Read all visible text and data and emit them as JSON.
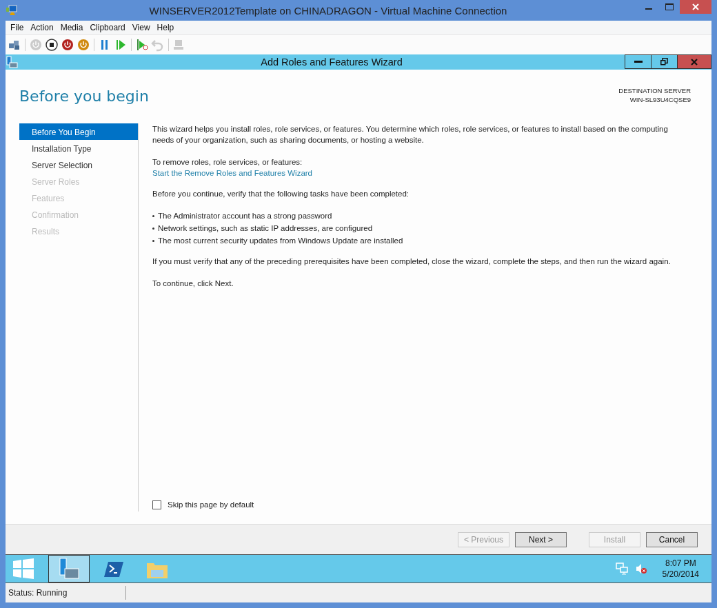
{
  "window": {
    "title": "WINSERVER2012Template on CHINADRAGON - Virtual Machine Connection"
  },
  "menu": [
    "File",
    "Action",
    "Media",
    "Clipboard",
    "View",
    "Help"
  ],
  "toolbar": [
    {
      "kind": "ctrl-alt-del",
      "disabled": false
    },
    {
      "kind": "start",
      "disabled": true
    },
    {
      "kind": "turn-off",
      "disabled": false
    },
    {
      "kind": "shut-down",
      "disabled": false
    },
    {
      "kind": "save",
      "disabled": false
    },
    {
      "kind": "pause",
      "disabled": false
    },
    {
      "kind": "reset",
      "disabled": false
    },
    {
      "kind": "checkpoint",
      "disabled": false
    },
    {
      "kind": "revert",
      "disabled": true
    },
    {
      "kind": "enhanced",
      "disabled": true
    }
  ],
  "wizard": {
    "title": "Add Roles and Features Wizard",
    "heading": "Before you begin",
    "destination_label": "DESTINATION SERVER",
    "destination_server": "WIN-SL93U4CQSE9",
    "steps": [
      {
        "label": "Before You Begin",
        "selected": true,
        "disabled": false
      },
      {
        "label": "Installation Type",
        "selected": false,
        "disabled": false
      },
      {
        "label": "Server Selection",
        "selected": false,
        "disabled": false
      },
      {
        "label": "Server Roles",
        "selected": false,
        "disabled": true
      },
      {
        "label": "Features",
        "selected": false,
        "disabled": true
      },
      {
        "label": "Confirmation",
        "selected": false,
        "disabled": true
      },
      {
        "label": "Results",
        "selected": false,
        "disabled": true
      }
    ],
    "intro": "This wizard helps you install roles, role services, or features. You determine which roles, role services, or features to install based on the computing needs of your organization, such as sharing documents, or hosting a website.",
    "remove_label": "To remove roles, role services, or features:",
    "remove_link": "Start the Remove Roles and Features Wizard",
    "verify_text": "Before you continue, verify that the following tasks have been completed:",
    "bullets": [
      "The Administrator account has a strong password",
      "Network settings, such as static IP addresses, are configured",
      "The most current security updates from Windows Update are installed"
    ],
    "warning": "If you must verify that any of the preceding prerequisites have been completed, close the wizard, complete the steps, and then run the wizard again.",
    "continue_text": "To continue, click Next.",
    "skip_checkbox": {
      "label": "Skip this page by default",
      "checked": false
    },
    "buttons": [
      {
        "label": "< Previous",
        "disabled": true
      },
      {
        "label": "Next >",
        "disabled": false
      },
      {
        "label": "Install",
        "disabled": true
      },
      {
        "label": "Cancel",
        "disabled": false
      }
    ]
  },
  "taskbar": {
    "items": [
      {
        "kind": "start",
        "selected": false
      },
      {
        "kind": "server-manager",
        "selected": true
      },
      {
        "kind": "powershell",
        "selected": false
      },
      {
        "kind": "explorer",
        "selected": false
      }
    ],
    "time": "8:07 PM",
    "date": "5/20/2014"
  },
  "status_bar": "Status: Running"
}
